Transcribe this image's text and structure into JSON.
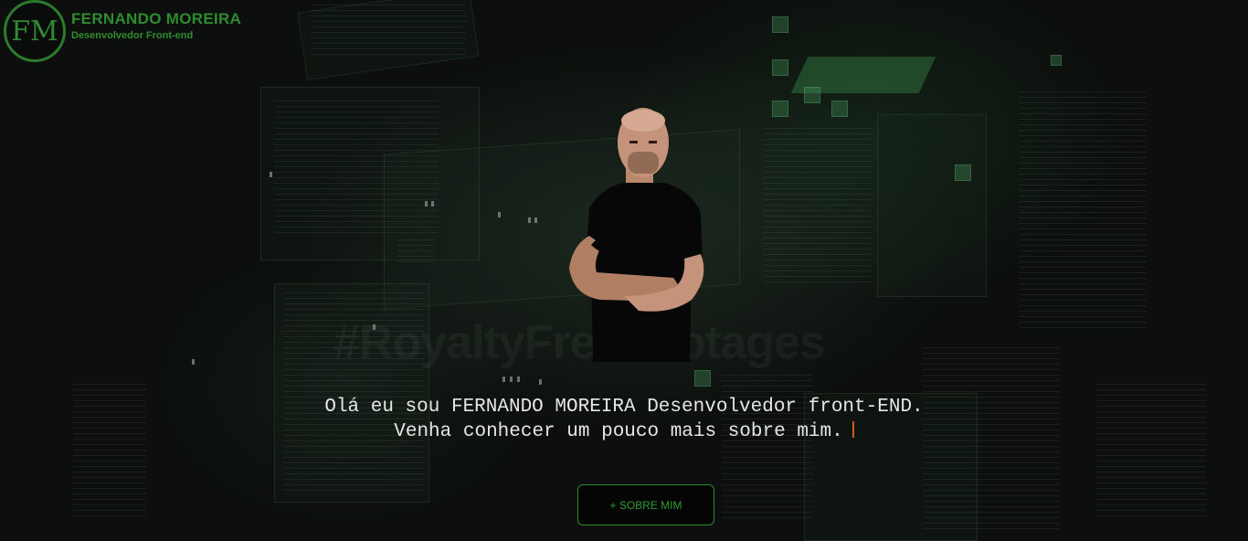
{
  "header": {
    "logo_initials": "FM",
    "brand_name": "FERNANDO MOREIRA",
    "brand_role": "Desenvolvedor Front-end"
  },
  "hero": {
    "intro_text": "Olá eu sou FERNANDO MOREIRA Desenvolvedor front-END. Venha conhecer um pouco mais sobre mim.",
    "cta_label": "+ SOBRE MIM"
  },
  "background": {
    "watermark": "#RoyaltyFreeFootages"
  },
  "colors": {
    "accent_green": "#2e8b2e",
    "background": "#0c0f0d",
    "cursor": "#d05a1a",
    "text": "#e6e6e6"
  },
  "icons": {
    "portrait": "person-photo"
  }
}
